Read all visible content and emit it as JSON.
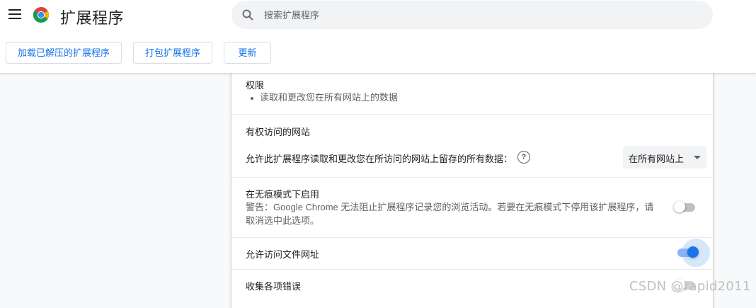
{
  "app": {
    "title": "扩展程序"
  },
  "search": {
    "placeholder": "搜索扩展程序"
  },
  "toolbar": {
    "load_unpacked": "加载已解压的扩展程序",
    "pack": "打包扩展程序",
    "update": "更新"
  },
  "permissions": {
    "heading": "权限",
    "items": [
      "读取和更改您在所有网站上的数据"
    ]
  },
  "site_access": {
    "heading": "有权访问的网站",
    "description": "允许此扩展程序读取和更改您在所访问的网站上留存的所有数据：",
    "help_icon": "question-circle-icon",
    "selected": "在所有网站上"
  },
  "incognito": {
    "heading": "在无痕模式下启用",
    "warning_line1": "警告：Google Chrome 无法阻止扩展程序记录您的浏览活动。若要在无痕模式下停用该扩展程序，请",
    "warning_line2": "取消选中此选项。",
    "enabled": false
  },
  "file_urls": {
    "label": "允许访问文件网址",
    "enabled": true
  },
  "errors": {
    "label": "收集各项错误"
  },
  "watermark": "CSDN @rapid2011",
  "colors": {
    "accent": "#1a73e8",
    "accent_light": "#8ab4f8",
    "text": "#202124",
    "secondary": "#5f6368"
  }
}
